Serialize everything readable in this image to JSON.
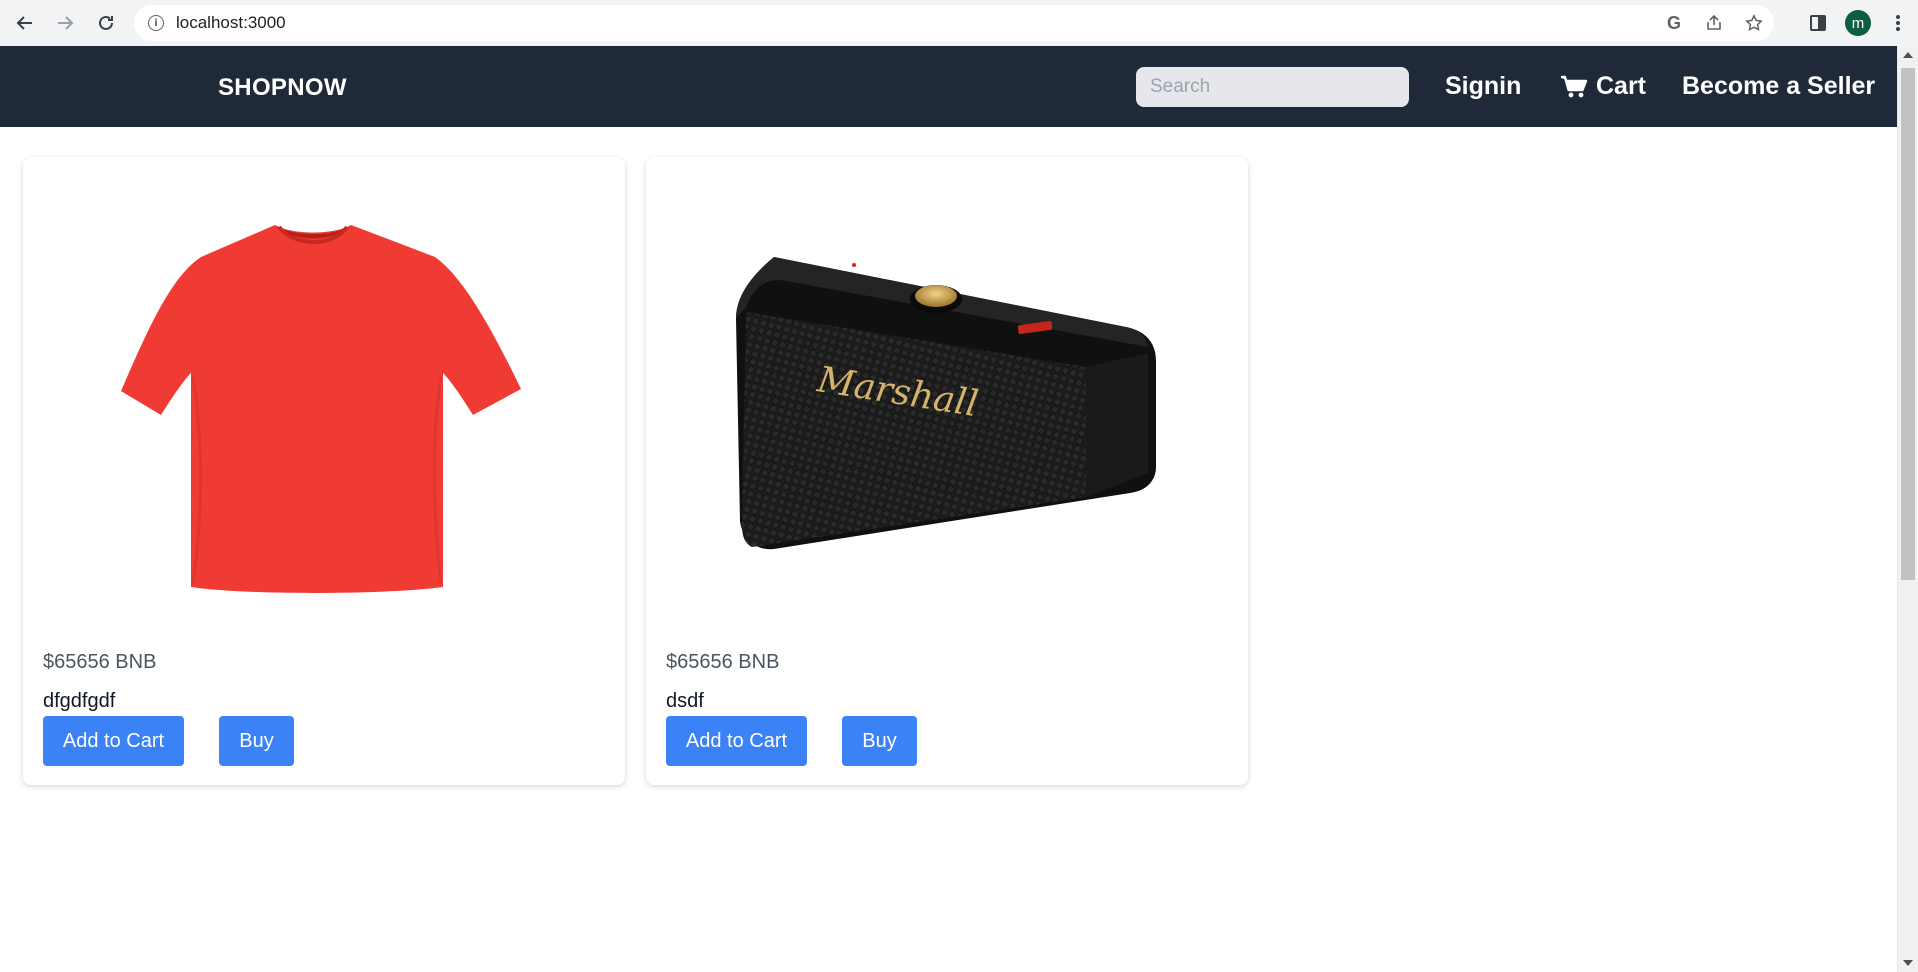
{
  "browser": {
    "url": "localhost:3000",
    "profile_initial": "m",
    "icons": [
      "back-icon",
      "forward-icon",
      "reload-icon",
      "site-info-icon",
      "google-icon",
      "share-icon",
      "bookmark-star-icon",
      "side-panel-icon",
      "menu-dots-icon"
    ]
  },
  "header": {
    "brand": "SHOPNOW",
    "search_placeholder": "Search",
    "signin_label": "Signin",
    "cart_label": "Cart",
    "seller_label": "Become a Seller",
    "bg_color": "#1f2937"
  },
  "products": [
    {
      "image": "red-tshirt",
      "price": "$65656 BNB",
      "name": "dfgdfgdf",
      "add_to_cart_label": "Add to Cart",
      "buy_label": "Buy"
    },
    {
      "image": "black-speaker",
      "price": "$65656 BNB",
      "name": "dsdf",
      "add_to_cart_label": "Add to Cart",
      "buy_label": "Buy",
      "image_logo_text": "Marshall"
    }
  ],
  "colors": {
    "button": "#3b82f6",
    "accent_red": "#ef3b33"
  }
}
